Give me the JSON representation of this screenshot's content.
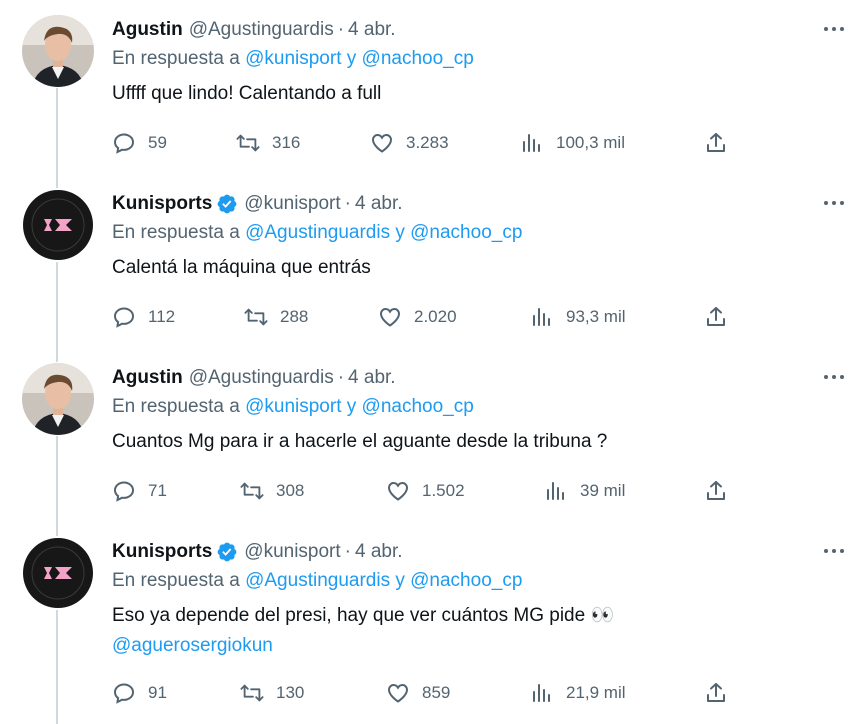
{
  "reply_prefix": "En respuesta a",
  "connector": "y",
  "more_label": "···",
  "tweets": [
    {
      "name": "Agustin",
      "handle": "@Agustinguardis",
      "sep": "·",
      "date": "4 abr.",
      "verified": false,
      "reply_mentions": [
        "@kunisport",
        "@nachoo_cp"
      ],
      "text": "Uffff que lindo! Calentando a full",
      "text_mention": "",
      "replies": "59",
      "retweets": "316",
      "likes": "3.283",
      "views": "100,3 mil"
    },
    {
      "name": "Kunisports",
      "handle": "@kunisport",
      "sep": "·",
      "date": "4 abr.",
      "verified": true,
      "reply_mentions": [
        "@Agustinguardis",
        "@nachoo_cp"
      ],
      "text": "Calentá la máquina que entrás",
      "text_mention": "",
      "replies": "112",
      "retweets": "288",
      "likes": "2.020",
      "views": "93,3 mil"
    },
    {
      "name": "Agustin",
      "handle": "@Agustinguardis",
      "sep": "·",
      "date": "4 abr.",
      "verified": false,
      "reply_mentions": [
        "@kunisport",
        "@nachoo_cp"
      ],
      "text": "Cuantos Mg para ir a hacerle el aguante desde la tribuna ?",
      "text_mention": "",
      "replies": "71",
      "retweets": "308",
      "likes": "1.502",
      "views": "39 mil"
    },
    {
      "name": "Kunisports",
      "handle": "@kunisport",
      "sep": "·",
      "date": "4 abr.",
      "verified": true,
      "reply_mentions": [
        "@Agustinguardis",
        "@nachoo_cp"
      ],
      "text": "Eso ya depende del presi, hay que ver cuántos MG pide 👀",
      "text_mention": "@aguerosergiokun",
      "replies": "91",
      "retweets": "130",
      "likes": "859",
      "views": "21,9 mil"
    }
  ],
  "colors": {
    "link": "#1d9bf0",
    "secondary": "#536471",
    "text": "#0f1419",
    "verified": "#1d9bf0",
    "thread_line": "#cfd9de"
  }
}
